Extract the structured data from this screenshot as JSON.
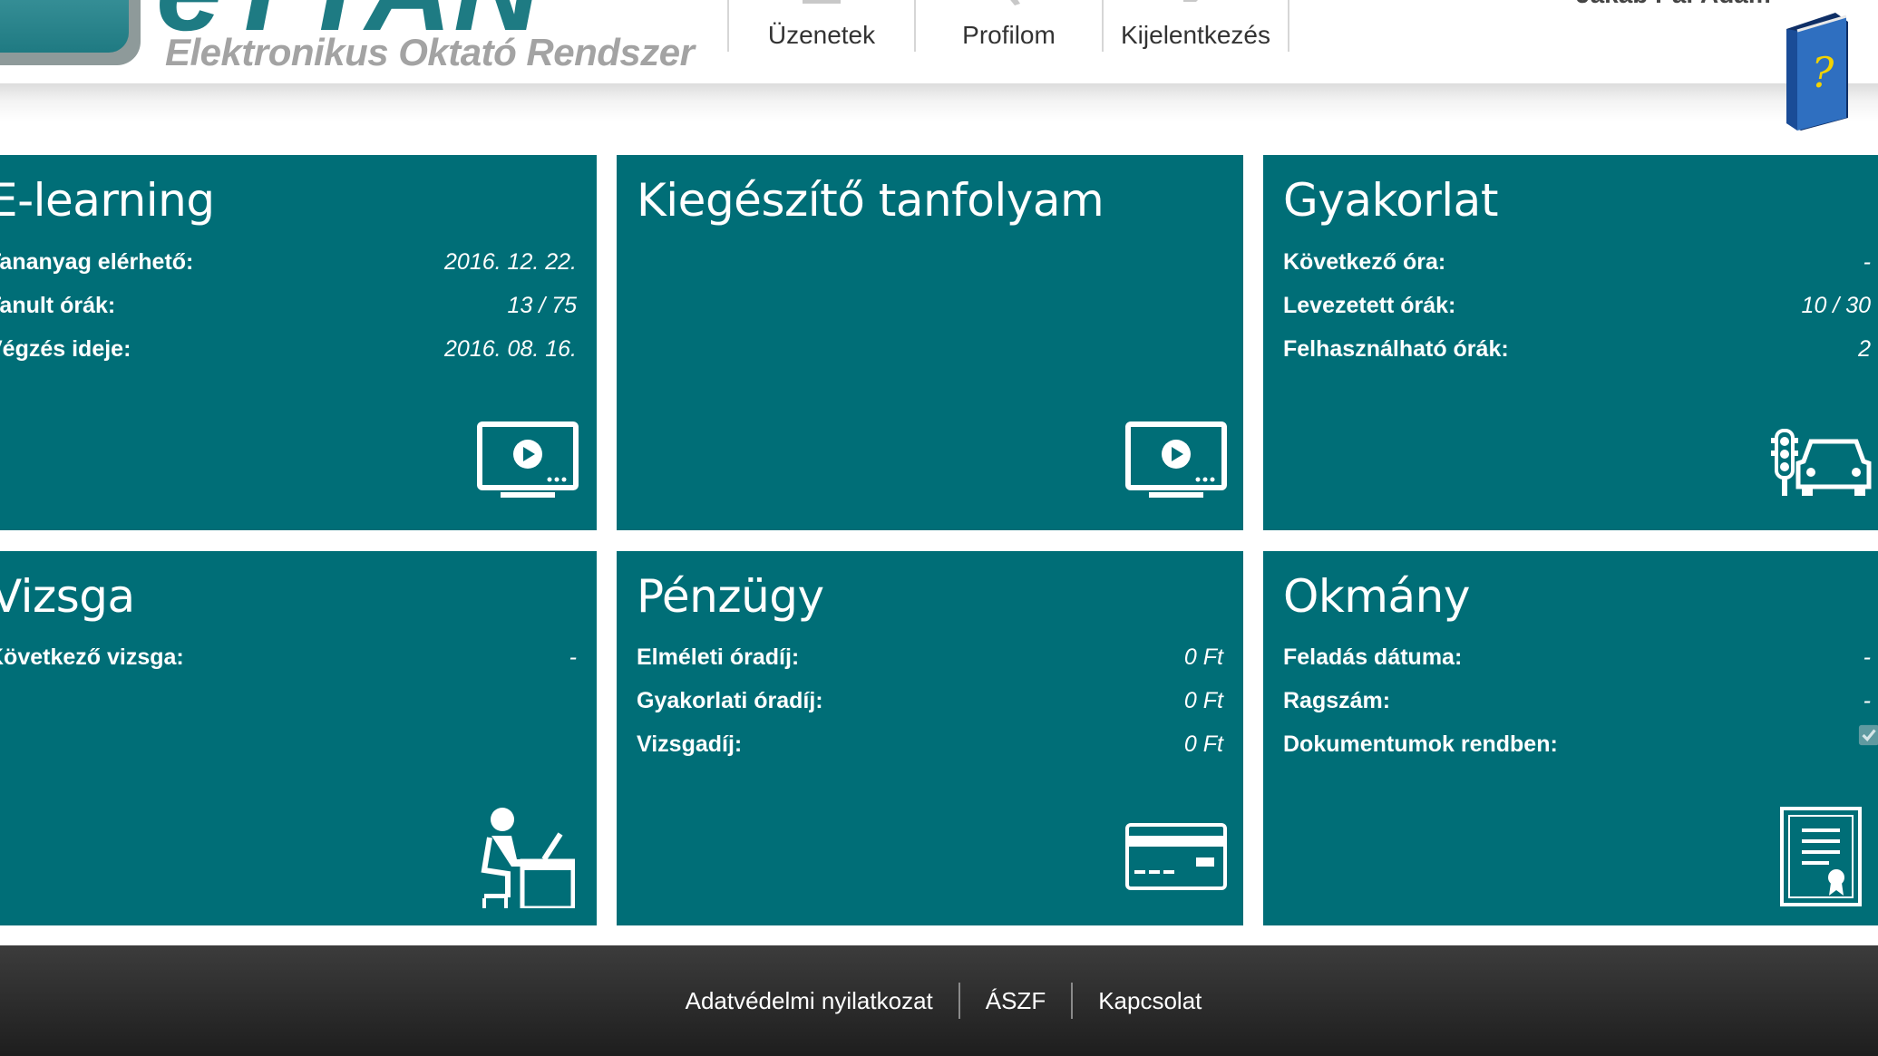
{
  "header": {
    "logo_brand": "eTTAN",
    "logo_subtitle": "Elektronikus Oktató Rendszer",
    "nav": [
      {
        "label": "Üzenetek",
        "icon": "envelope-icon"
      },
      {
        "label": "Profilom",
        "icon": "wrench-icon"
      },
      {
        "label": "Kijelentkezés",
        "icon": "logout-icon"
      }
    ],
    "user_name": "Jakab Pál Ádám",
    "help_icon": "help-book-icon"
  },
  "tiles": [
    {
      "title": "E-learning",
      "icon": "monitor-play-icon",
      "rows": [
        {
          "label": "Tananyag elérhető:",
          "value": "2016. 12. 22."
        },
        {
          "label": "Tanult órák:",
          "value": "13 / 75"
        },
        {
          "label": "Végzés ideje:",
          "value": "2016. 08. 16."
        }
      ]
    },
    {
      "title": "Kiegészítő tanfolyam",
      "icon": "monitor-play-icon",
      "rows": []
    },
    {
      "title": "Gyakorlat",
      "icon": "traffic-light-car-icon",
      "rows": [
        {
          "label": "Következő óra:",
          "value": "-"
        },
        {
          "label": "Levezetett órák:",
          "value": "10 / 30"
        },
        {
          "label": "Felhasználható órák:",
          "value": "2"
        }
      ]
    },
    {
      "title": "Vizsga",
      "icon": "person-at-desk-icon",
      "rows": [
        {
          "label": "Következő vizsga:",
          "value": "-"
        }
      ]
    },
    {
      "title": "Pénzügy",
      "icon": "credit-card-icon",
      "rows": [
        {
          "label": "Elméleti óradíj:",
          "value": "0 Ft"
        },
        {
          "label": "Gyakorlati óradíj:",
          "value": "0 Ft"
        },
        {
          "label": "Vizsgadíj:",
          "value": "0 Ft"
        }
      ]
    },
    {
      "title": "Okmány",
      "icon": "certificate-icon",
      "rows": [
        {
          "label": "Feladás dátuma:",
          "value": "-"
        },
        {
          "label": "Ragszám:",
          "value": "-"
        },
        {
          "label": "Dokumentumok rendben:",
          "value": ""
        }
      ],
      "documents_ok": true
    }
  ],
  "footer": {
    "links": [
      "Adatvédelmi nyilatkozat",
      "ÁSZF",
      "Kapcsolat"
    ]
  },
  "colors": {
    "tile_bg": "#006e77",
    "footer_bg": "#2a2a2a",
    "brand": "#1e7b83"
  }
}
